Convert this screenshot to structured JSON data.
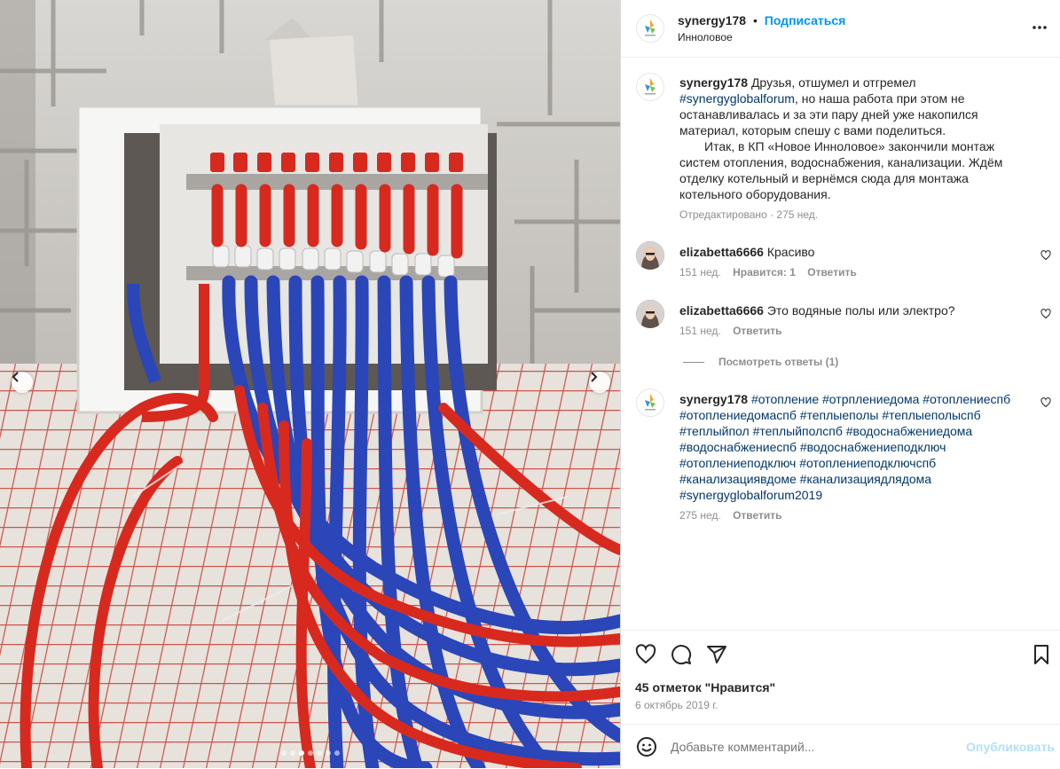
{
  "header": {
    "username": "synergy178",
    "separator": "•",
    "follow_label": "Подписаться",
    "location": "Инноловое"
  },
  "caption": {
    "username": "synergy178",
    "text_before": "Друзья, отшумел и отгремел",
    "hashtag": "#synergyglobalforum",
    "text_after": ", но наша работа при этом не останавливалась и за эти пару дней уже накопился материал, которым спешу с вами поделиться.",
    "paragraph2": "Итак, в КП «Новое Инноловое» закончили монтаж систем отопления, водоснабжения, канализации. Ждём отделку котельный и вернёмся сюда для монтажа котельного оборудования.",
    "meta": "Отредактировано · 275 нед."
  },
  "comments": [
    {
      "username": "elizabetta6666",
      "text": "Красиво",
      "time": "151 нед.",
      "likes": "Нравится: 1",
      "reply": "Ответить"
    },
    {
      "username": "elizabetta6666",
      "text": "Это водяные полы или электро?",
      "time": "151 нед.",
      "reply": "Ответить",
      "view_replies": "Посмотреть ответы (1)"
    },
    {
      "username": "synergy178",
      "hashtags": "#отопление #отрплениедома #отоплениеспб #отоплениедомаспб #теплыеполы #теплыеполыспб #теплыйпол #теплыйполспб #водоснабжениедома #водоснабжениеспб #водоснабжениеподключ #отоплениеподключ #отоплениеподключспб #канализациявдоме #канализациядлядома #synergyglobalforum2019",
      "time": "275 нед.",
      "reply": "Ответить"
    }
  ],
  "footer": {
    "likes": "45 отметок \"Нравится\"",
    "date": "6 октябрь 2019 г.",
    "comment_placeholder": "Добавьте комментарий...",
    "publish_label": "Опубликовать"
  },
  "carousel": {
    "total": 7,
    "active_index": 2
  },
  "colors": {
    "accent": "#0095f6",
    "hashtag": "#00376b",
    "muted": "#8e8e8e",
    "pipe_red": "#d8291f",
    "pipe_blue": "#2a46b8"
  },
  "icons": [
    "chevron-left-icon",
    "chevron-right-icon",
    "more-icon",
    "heart-icon",
    "comment-icon",
    "share-icon",
    "bookmark-icon",
    "emoji-icon"
  ]
}
